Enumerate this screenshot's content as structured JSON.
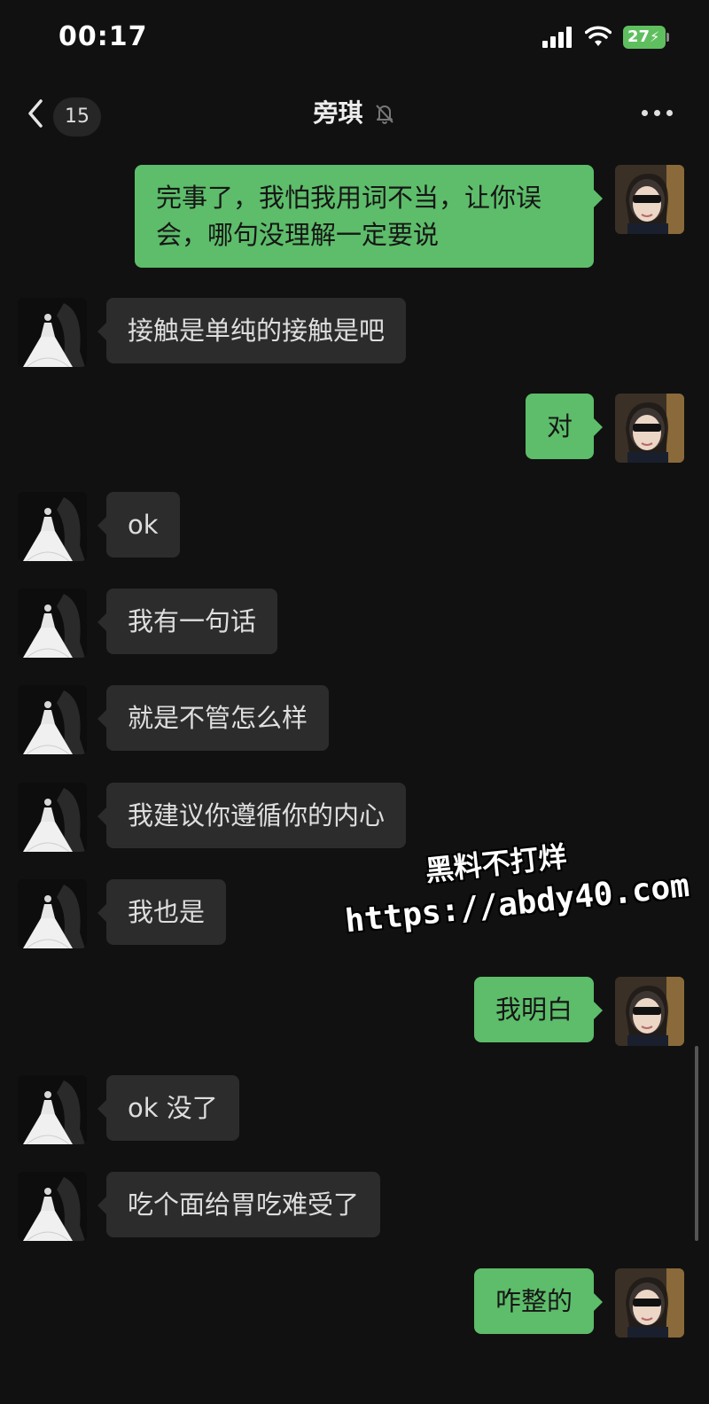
{
  "status_bar": {
    "time": "00:17",
    "battery": "27"
  },
  "header": {
    "unread_count": "15",
    "title": "旁琪"
  },
  "messages": [
    {
      "side": "out",
      "text": "完事了，我怕我用词不当，让你误\n会，哪句没理解一定要说"
    },
    {
      "side": "in",
      "text": "接触是单纯的接触是吧"
    },
    {
      "side": "out",
      "text": "对"
    },
    {
      "side": "in",
      "text": "ok"
    },
    {
      "side": "in",
      "text": "我有一句话"
    },
    {
      "side": "in",
      "text": "就是不管怎么样"
    },
    {
      "side": "in",
      "text": "我建议你遵循你的内心"
    },
    {
      "side": "in",
      "text": "我也是"
    },
    {
      "side": "out",
      "text": "我明白"
    },
    {
      "side": "in",
      "text": "ok 没了"
    },
    {
      "side": "in",
      "text": "吃个面给胃吃难受了"
    },
    {
      "side": "out",
      "text": "咋整的"
    }
  ],
  "watermark": {
    "line1": "黑料不打烊",
    "line2": "https://abdy40.com"
  }
}
